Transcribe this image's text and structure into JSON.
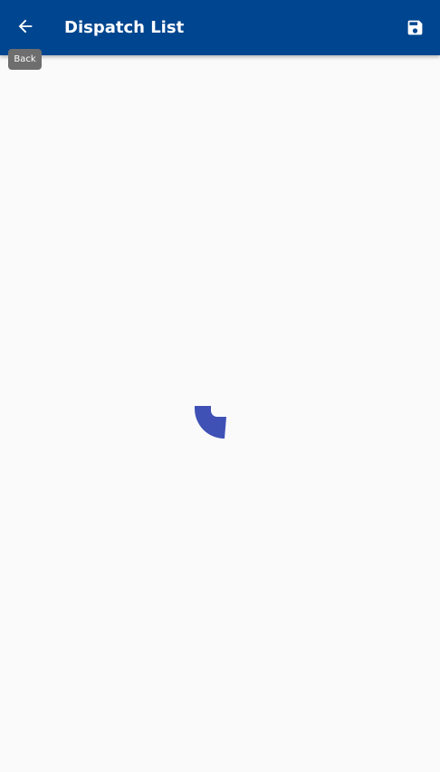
{
  "header": {
    "title": "Dispatch List",
    "back_icon": "arrow-left-icon",
    "save_icon": "floppy-disk-icon"
  },
  "tooltip": {
    "text": "Back"
  },
  "loading": {
    "icon": "loading-spinner-icon"
  },
  "colors": {
    "appbar": "#00458f",
    "background": "#fafafa",
    "spinner": "#3f51b5",
    "tooltip": "#6e6e6e"
  }
}
